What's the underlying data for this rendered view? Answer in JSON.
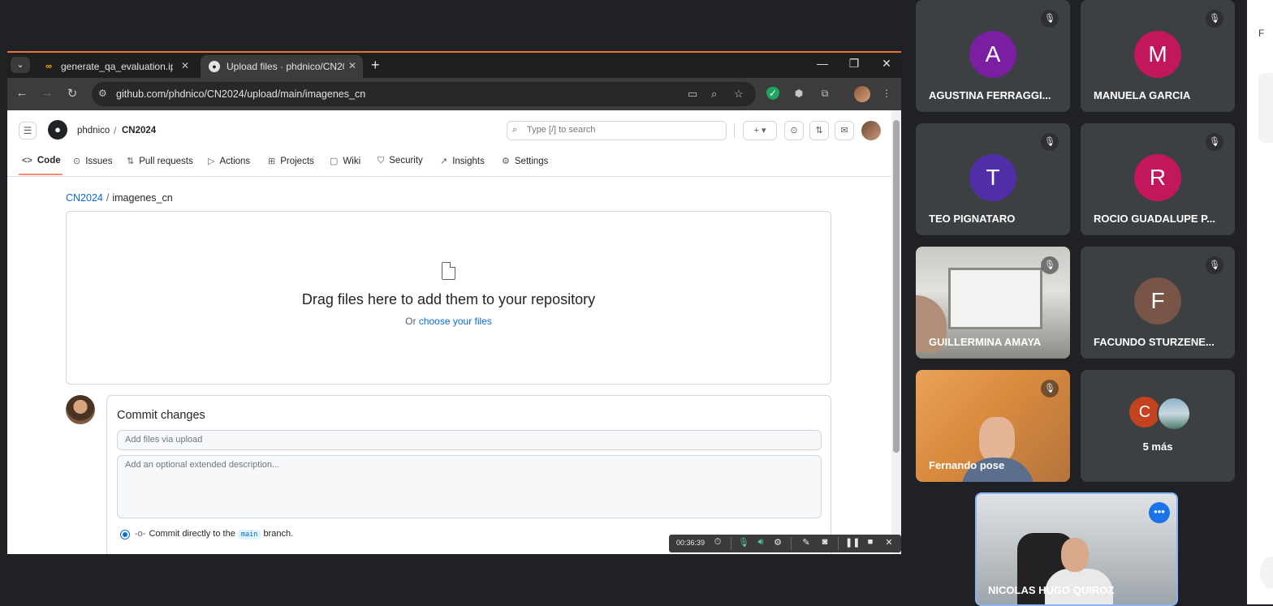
{
  "browser": {
    "tabs": [
      {
        "title": "generate_qa_evaluation.ipynb -",
        "icon": "colab-icon",
        "active": false
      },
      {
        "title": "Upload files · phdnico/CN2024",
        "icon": "github-icon",
        "active": true
      }
    ],
    "url": "github.com/phdnico/CN2024/upload/main/imagenes_cn"
  },
  "github": {
    "owner": "phdnico",
    "repo": "CN2024",
    "search_placeholder": "Type [/] to search",
    "nav": [
      "Code",
      "Issues",
      "Pull requests",
      "Actions",
      "Projects",
      "Wiki",
      "Security",
      "Insights",
      "Settings"
    ],
    "path": {
      "repo": "CN2024",
      "folder": "imagenes_cn"
    },
    "dropzone": {
      "title": "Drag files here to add them to your repository",
      "or": "Or",
      "link": "choose your files"
    },
    "commit": {
      "title": "Commit changes",
      "summary_placeholder": "Add files via upload",
      "description_placeholder": "Add an optional extended description...",
      "option_prefix": "Commit directly to the",
      "branch": "main",
      "option_suffix": "branch."
    }
  },
  "recording": {
    "timer": "00:36:39"
  },
  "meet": {
    "participants": [
      {
        "name": "AGUSTINA FERRAGGI...",
        "initial": "A",
        "color": "#7b1fa2"
      },
      {
        "name": "MANUELA GARCIA",
        "initial": "M",
        "color": "#c2185b"
      },
      {
        "name": "TEO PIGNATARO",
        "initial": "T",
        "color": "#512da8"
      },
      {
        "name": "ROCIO GUADALUPE P...",
        "initial": "R",
        "color": "#c2185b"
      },
      {
        "name": "GUILLERMINA AMAYA",
        "initial": "",
        "color": ""
      },
      {
        "name": "FACUNDO STURZENE...",
        "initial": "F",
        "color": "#795548"
      },
      {
        "name": "Fernando pose",
        "initial": "",
        "color": ""
      }
    ],
    "more": {
      "initial": "C",
      "label": "5 más"
    },
    "self": {
      "name": "NICOLAS HUGO QUIROZ"
    }
  },
  "sidepanel": {
    "top_letter": "F"
  }
}
